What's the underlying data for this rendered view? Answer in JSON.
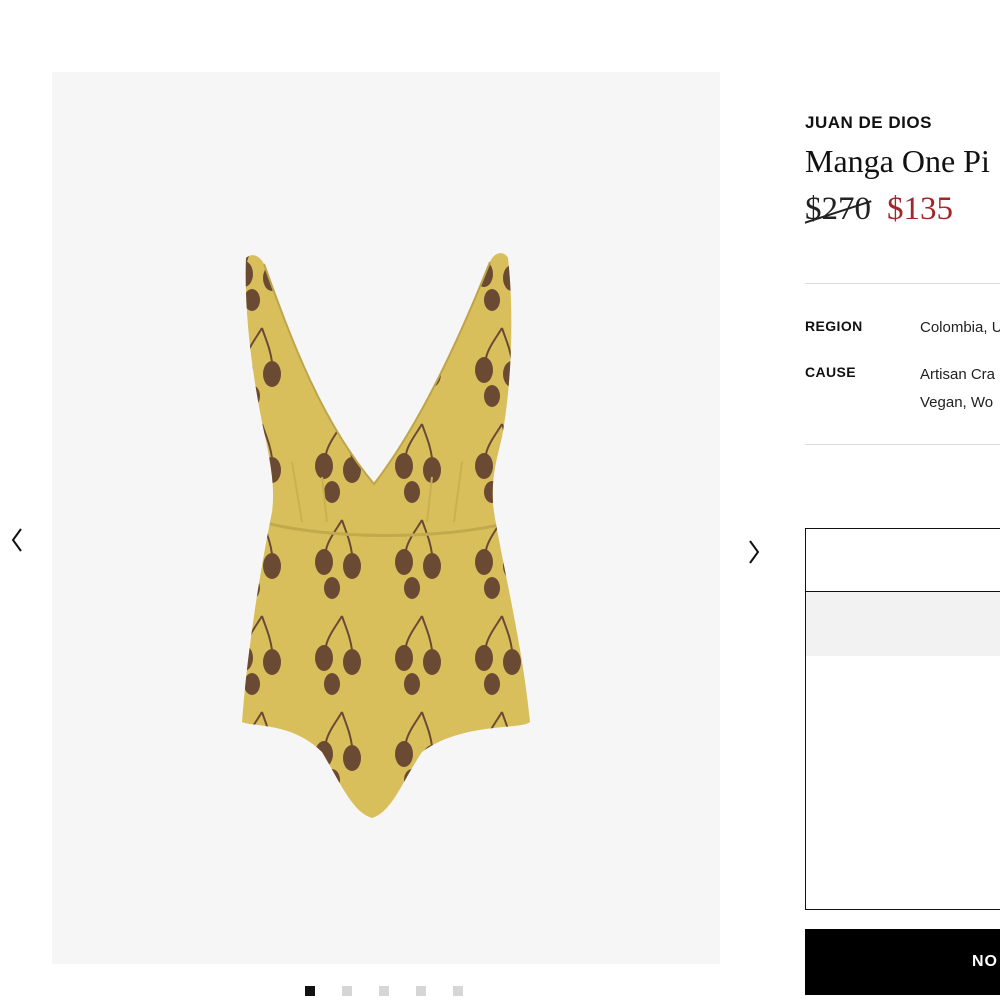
{
  "product": {
    "brand": "JUAN DE DIOS",
    "title": "Manga One Pi",
    "price_original": "$270",
    "price_sale": "$135"
  },
  "specs": {
    "region_label": "REGION",
    "region_value": "Colombia, U",
    "cause_label": "CAUSE",
    "cause_value_line1": "Artisan Cra",
    "cause_value_line2": "Vegan,  Wo"
  },
  "cart": {
    "button_label": "NO"
  },
  "gallery": {
    "image_count": 5,
    "active_index": 0,
    "icons": {
      "prev": "chevron-left-icon",
      "next": "chevron-right-icon"
    },
    "product_colors": {
      "fabric": "#d8bf5c",
      "print": "#6b4a33",
      "background": "#f6f6f6"
    }
  },
  "colors": {
    "sale_price": "#a3262a",
    "button_background": "#000000"
  }
}
